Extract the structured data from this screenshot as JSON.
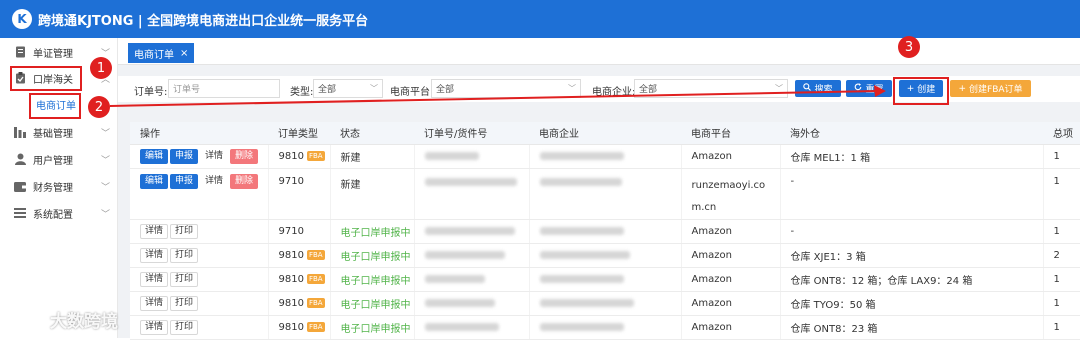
{
  "header": {
    "logo_glyph": "K",
    "title": "跨境通KJTONG | 全国跨境电商进出口企业统一服务平台"
  },
  "sidebar": {
    "items": [
      {
        "label": "单证管理",
        "icon": "document-icon"
      },
      {
        "label": "口岸海关",
        "icon": "clipboard-icon"
      },
      {
        "label": "基础管理",
        "icon": "bars-icon"
      },
      {
        "label": "用户管理",
        "icon": "user-icon"
      },
      {
        "label": "财务管理",
        "icon": "wallet-icon"
      },
      {
        "label": "系统配置",
        "icon": "list-icon"
      }
    ],
    "sub_item": "电商订单"
  },
  "tabs": [
    {
      "label": "电商订单",
      "close": "×"
    }
  ],
  "filter": {
    "order_no_label": "订单号:",
    "order_no_placeholder": "订单号",
    "type_label": "类型:",
    "type_value": "全部",
    "platform_label": "电商平台:",
    "platform_value": "全部",
    "company_label": "电商企业:",
    "company_value": "全部",
    "search_btn": "搜索",
    "reset_btn": "重置",
    "create_btn": "创建",
    "create_fba_btn": "创建FBA订单"
  },
  "table": {
    "headers": [
      "操作",
      "订单类型",
      "状态",
      "订单号/货件号",
      "电商企业",
      "电商平台",
      "海外仓",
      "总项"
    ],
    "action_labels": {
      "edit": "编辑",
      "declare": "申报",
      "detail": "详情",
      "delete": "删除",
      "print": "打印"
    },
    "rows": [
      {
        "type": "9810",
        "fba": "FBA",
        "status": "新建",
        "platform": "Amazon",
        "warehouse": "仓库 MEL1：1 箱",
        "total": "1"
      },
      {
        "type": "9710",
        "fba": "",
        "status": "新建",
        "platform": "runzemaoyi.com.cn",
        "warehouse": "-",
        "total": "1"
      },
      {
        "type": "9710",
        "fba": "",
        "status": "电子口岸申报中",
        "platform": "Amazon",
        "warehouse": "-",
        "total": "1"
      },
      {
        "type": "9810",
        "fba": "FBA",
        "status": "电子口岸申报中",
        "platform": "Amazon",
        "warehouse": "仓库 XJE1：3 箱",
        "total": "2"
      },
      {
        "type": "9810",
        "fba": "FBA",
        "status": "电子口岸申报中",
        "platform": "Amazon",
        "warehouse": "仓库 ONT8：12 箱；仓库 LAX9：24 箱",
        "total": "1"
      },
      {
        "type": "9810",
        "fba": "FBA",
        "status": "电子口岸申报中",
        "platform": "Amazon",
        "warehouse": "仓库 TYO9：50 箱",
        "total": "1"
      },
      {
        "type": "9810",
        "fba": "FBA",
        "status": "电子口岸申报中",
        "platform": "Amazon",
        "warehouse": "仓库 ONT8：23 箱",
        "total": "1"
      }
    ]
  },
  "annotations": [
    "1",
    "2",
    "3"
  ],
  "watermark": "大数跨境",
  "colors": {
    "primary": "#1e70d6",
    "danger": "#f3777b",
    "orange": "#f4a73a",
    "green": "#52b44a",
    "annotation": "#e02020"
  }
}
